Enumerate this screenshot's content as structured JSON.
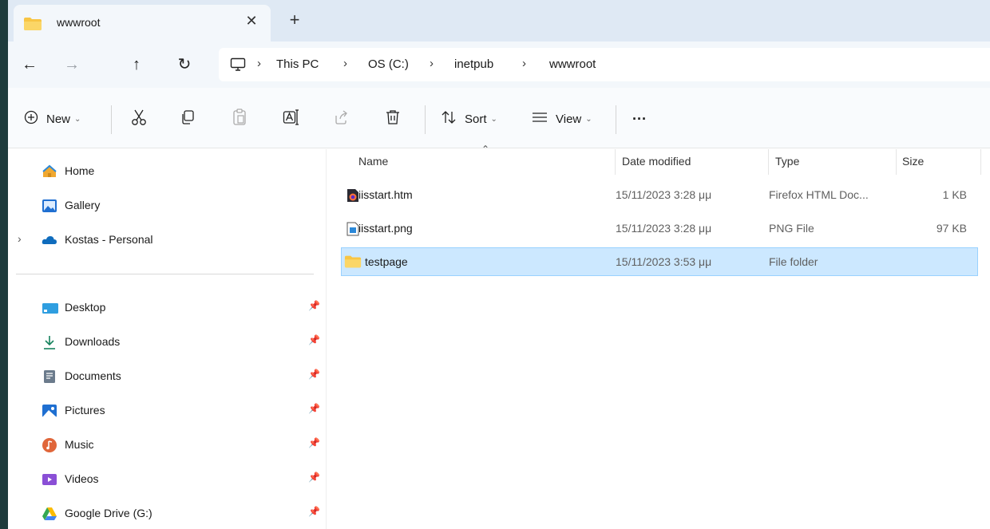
{
  "tab": {
    "title": "wwwroot",
    "close_glyph": "✕",
    "new_tab_glyph": "+"
  },
  "nav": {
    "back": "←",
    "forward": "→",
    "up": "↑",
    "refresh": "↻"
  },
  "breadcrumb": {
    "items": [
      "This PC",
      "OS (C:)",
      "inetpub",
      "wwwroot"
    ],
    "separator": "›"
  },
  "toolbar": {
    "new_label": "New",
    "sort_label": "Sort",
    "view_label": "View",
    "more_glyph": "···"
  },
  "sidebar": {
    "top_items": [
      {
        "label": "Home",
        "icon": "home-icon"
      },
      {
        "label": "Gallery",
        "icon": "gallery-icon"
      },
      {
        "label": "Kostas - Personal",
        "icon": "onedrive-icon",
        "expandable": true
      }
    ],
    "pinned_items": [
      {
        "label": "Desktop",
        "icon": "desktop-icon"
      },
      {
        "label": "Downloads",
        "icon": "downloads-icon"
      },
      {
        "label": "Documents",
        "icon": "documents-icon"
      },
      {
        "label": "Pictures",
        "icon": "pictures-icon"
      },
      {
        "label": "Music",
        "icon": "music-icon"
      },
      {
        "label": "Videos",
        "icon": "videos-icon"
      },
      {
        "label": "Google Drive (G:)",
        "icon": "google-drive-icon"
      }
    ]
  },
  "files": {
    "columns": {
      "name": "Name",
      "date": "Date modified",
      "type": "Type",
      "size": "Size"
    },
    "rows": [
      {
        "name": "iisstart.htm",
        "date": "15/11/2023 3:28 μμ",
        "type": "Firefox HTML Doc...",
        "size": "1 KB",
        "icon": "firefox-html-icon"
      },
      {
        "name": "iisstart.png",
        "date": "15/11/2023 3:28 μμ",
        "type": "PNG File",
        "size": "97 KB",
        "icon": "png-file-icon"
      },
      {
        "name": "testpage",
        "date": "15/11/2023 3:53 μμ",
        "type": "File folder",
        "size": "",
        "icon": "folder-icon",
        "selected": true
      }
    ]
  },
  "colors": {
    "accent": "#0067c0",
    "selection": "#cce8ff",
    "folder": "#f8c544"
  }
}
